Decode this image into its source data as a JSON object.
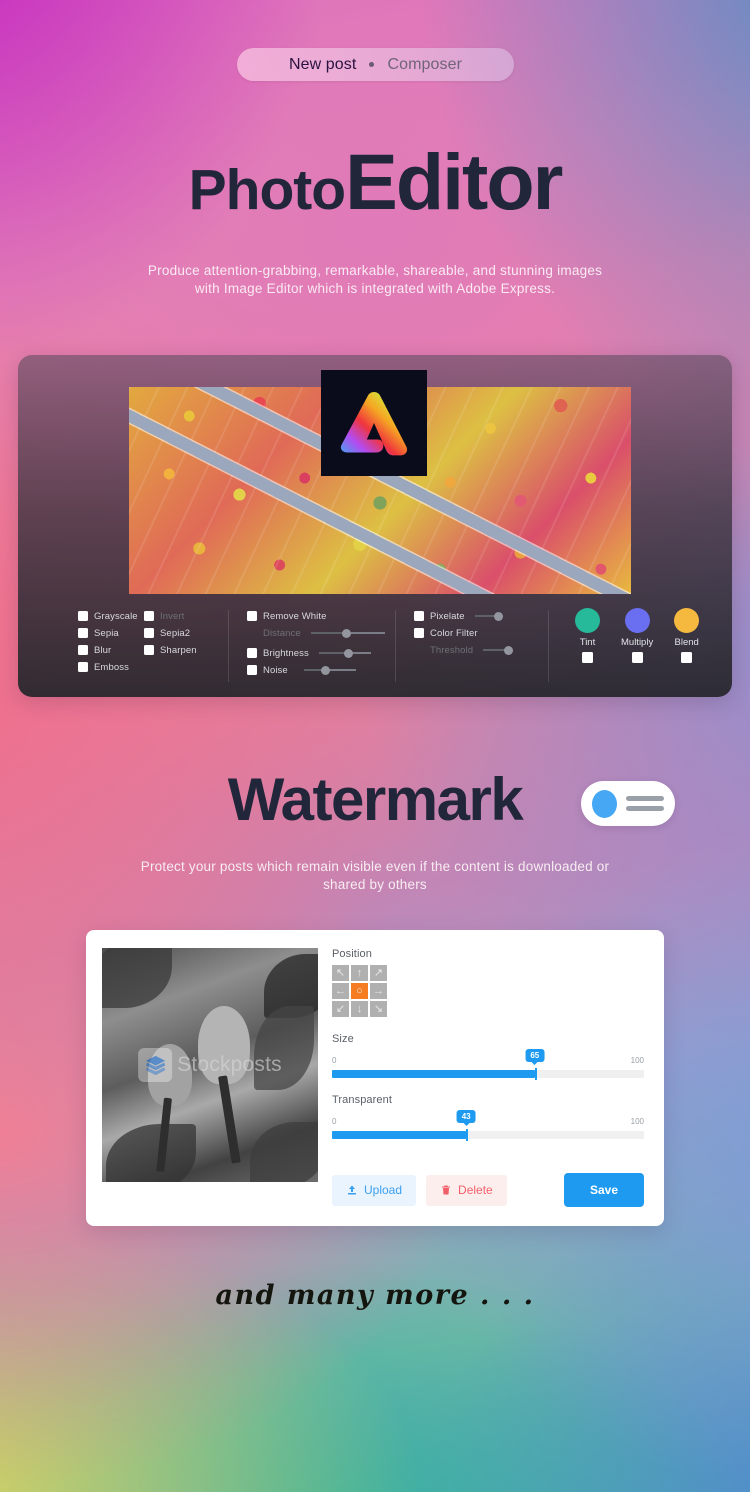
{
  "background": {
    "colors": [
      "#c429c0",
      "#e484b6",
      "#ef7f96",
      "#9c9fcc",
      "#36b49c",
      "#d9d35e",
      "#5a94c8"
    ]
  },
  "tabs": {
    "active_label": "New post",
    "separator": "•",
    "inactive_label": "Composer"
  },
  "hero": {
    "title_small": "Photo",
    "title_big": "Editor",
    "subtitle": "Produce attention-grabbing, remarkable, shareable, and stunning images with Image Editor which is integrated with Adobe Express."
  },
  "editor": {
    "logo_name": "adobe-express-logo",
    "photo_alt": "aerial-autumn-forest-road",
    "filters_col1": [
      {
        "label": "Grayscale",
        "checked": false,
        "dim": false
      },
      {
        "label": "Sepia",
        "checked": false,
        "dim": false
      },
      {
        "label": "Blur",
        "checked": false,
        "dim": false
      },
      {
        "label": "Emboss",
        "checked": false,
        "dim": false
      }
    ],
    "filters_col2": [
      {
        "label": "Invert",
        "checked": false,
        "dim": true
      },
      {
        "label": "Sepia2",
        "checked": false,
        "dim": false
      },
      {
        "label": "Sharpen",
        "checked": false,
        "dim": false
      }
    ],
    "filters_col3": [
      {
        "label": "Remove White",
        "checked": false,
        "dim": false,
        "slider": false
      },
      {
        "label": "Distance",
        "checked": null,
        "dim": true,
        "slider": true
      },
      {
        "label": "Brightness",
        "checked": false,
        "dim": false,
        "slider": true
      },
      {
        "label": "Noise",
        "checked": false,
        "dim": false,
        "slider": true
      }
    ],
    "filters_col4": [
      {
        "label": "Pixelate",
        "checked": false,
        "dim": false,
        "slider": true
      },
      {
        "label": "Color Filter",
        "checked": false,
        "dim": false,
        "slider": false
      },
      {
        "label": "Threshold",
        "checked": null,
        "dim": true,
        "slider": true
      }
    ],
    "blend_modes": [
      {
        "label": "Tint",
        "color": "#26b99a",
        "checked": false
      },
      {
        "label": "Multiply",
        "color": "#6a6ef0",
        "checked": false
      },
      {
        "label": "Blend",
        "color": "#f5b940",
        "checked": false
      }
    ]
  },
  "watermark": {
    "title": "Watermark",
    "toggle_state": "on",
    "subtitle": "Protect your posts which remain visible even if the content is downloaded or shared by others",
    "preview_alt": "grayscale-parrots-photo",
    "stamp_text": "Stockposts",
    "position_label": "Position",
    "position_selected": "center",
    "position_buttons": [
      "↖",
      "↑",
      "↗",
      "←",
      "○",
      "→",
      "↙",
      "↓",
      "↘"
    ],
    "size": {
      "label": "Size",
      "min": "0",
      "max": "100",
      "value": "65"
    },
    "transparent": {
      "label": "Transparent",
      "min": "0",
      "max": "100",
      "value": "43"
    },
    "buttons": {
      "upload": "Upload",
      "delete": "Delete",
      "save": "Save"
    }
  },
  "footer": {
    "text": "and many more . . ."
  }
}
